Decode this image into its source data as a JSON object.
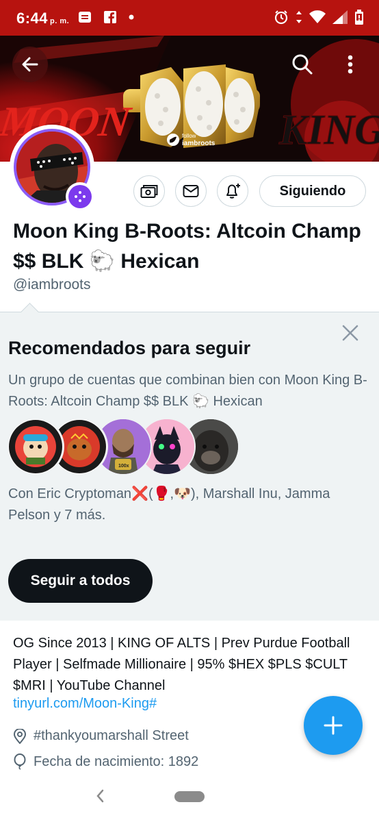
{
  "status_bar": {
    "time": "6:44",
    "ampm": "p. m."
  },
  "header": {
    "banner_text_left": "MOON",
    "banner_text_right": "KING",
    "banner_follow_label": "follow",
    "banner_handle": "iambroots"
  },
  "profile": {
    "display_name": "Moon King B-Roots: Altcoin Champ $$ BLK 🐑 Hexican",
    "handle": "@iambroots",
    "follow_button": "Siguiendo"
  },
  "recommended": {
    "title": "Recomendados para seguir",
    "subtitle": "Un grupo de cuentas que combinan bien con Moon King B-Roots: Altcoin Champ $$ BLK 🐑 Hexican",
    "with_text": "Con Eric Cryptoman❌(🥊,🐶), Marshall Inu, Jamma Pelson y 7 más.",
    "follow_all": "Seguir a todos"
  },
  "bio": {
    "text": "OG Since 2013 | KING OF ALTS | Prev Purdue Football Player | Selfmade Millionaire | 95% $HEX $PLS $CULT $MRI | YouTube Channel",
    "link": "tinyurl.com/Moon-King#",
    "location": "#thankyoumarshall Street",
    "birth": "Fecha de nacimiento: 1892"
  },
  "colors": {
    "status_bar": "#b7130f",
    "accent": "#1d9bf0",
    "panel_bg": "#eff3f4",
    "avatar_ring": "#8b5cf6"
  },
  "icons": {
    "back": "arrow-left-icon",
    "search": "search-icon",
    "more": "more-vertical-icon",
    "tip": "money-icon",
    "message": "mail-icon",
    "notify": "bell-plus-icon",
    "close": "close-icon",
    "location": "location-pin-icon",
    "birth": "balloon-icon",
    "compose": "plus-icon"
  }
}
